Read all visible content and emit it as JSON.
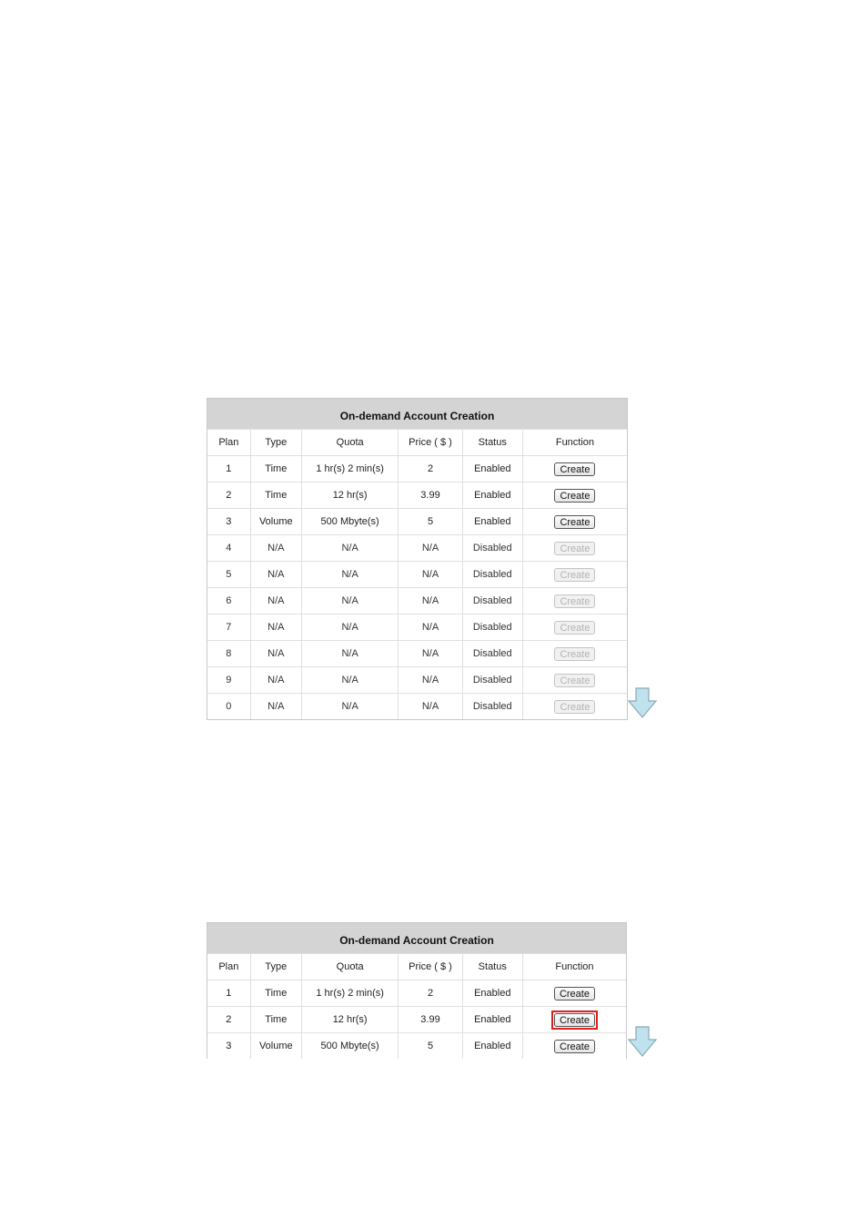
{
  "panel1": {
    "title": "On-demand Account Creation",
    "headers": [
      "Plan",
      "Type",
      "Quota",
      "Price ( $ )",
      "Status",
      "Function"
    ],
    "rows": [
      {
        "plan": "1",
        "type": "Time",
        "quota": "1 hr(s) 2 min(s)",
        "price": "2",
        "status": "Enabled",
        "button": "Create",
        "enabled": true
      },
      {
        "plan": "2",
        "type": "Time",
        "quota": "12 hr(s)",
        "price": "3.99",
        "status": "Enabled",
        "button": "Create",
        "enabled": true
      },
      {
        "plan": "3",
        "type": "Volume",
        "quota": "500 Mbyte(s)",
        "price": "5",
        "status": "Enabled",
        "button": "Create",
        "enabled": true
      },
      {
        "plan": "4",
        "type": "N/A",
        "quota": "N/A",
        "price": "N/A",
        "status": "Disabled",
        "button": "Create",
        "enabled": false
      },
      {
        "plan": "5",
        "type": "N/A",
        "quota": "N/A",
        "price": "N/A",
        "status": "Disabled",
        "button": "Create",
        "enabled": false
      },
      {
        "plan": "6",
        "type": "N/A",
        "quota": "N/A",
        "price": "N/A",
        "status": "Disabled",
        "button": "Create",
        "enabled": false
      },
      {
        "plan": "7",
        "type": "N/A",
        "quota": "N/A",
        "price": "N/A",
        "status": "Disabled",
        "button": "Create",
        "enabled": false
      },
      {
        "plan": "8",
        "type": "N/A",
        "quota": "N/A",
        "price": "N/A",
        "status": "Disabled",
        "button": "Create",
        "enabled": false
      },
      {
        "plan": "9",
        "type": "N/A",
        "quota": "N/A",
        "price": "N/A",
        "status": "Disabled",
        "button": "Create",
        "enabled": false
      },
      {
        "plan": "0",
        "type": "N/A",
        "quota": "N/A",
        "price": "N/A",
        "status": "Disabled",
        "button": "Create",
        "enabled": false
      }
    ]
  },
  "panel2": {
    "title": "On-demand Account Creation",
    "headers": [
      "Plan",
      "Type",
      "Quota",
      "Price ( $ )",
      "Status",
      "Function"
    ],
    "rows": [
      {
        "plan": "1",
        "type": "Time",
        "quota": "1 hr(s) 2 min(s)",
        "price": "2",
        "status": "Enabled",
        "button": "Create",
        "enabled": true,
        "highlight": false
      },
      {
        "plan": "2",
        "type": "Time",
        "quota": "12 hr(s)",
        "price": "3.99",
        "status": "Enabled",
        "button": "Create",
        "enabled": true,
        "highlight": true
      },
      {
        "plan": "3",
        "type": "Volume",
        "quota": "500 Mbyte(s)",
        "price": "5",
        "status": "Enabled",
        "button": "Create",
        "enabled": true,
        "highlight": false
      }
    ]
  },
  "icons": {
    "arrow": "arrow-down-icon"
  },
  "colors": {
    "title_bg": "#d4d4d4",
    "highlight": "#d9201f",
    "arrow_fill": "#bfe3ee",
    "arrow_stroke": "#8aa8b2"
  }
}
